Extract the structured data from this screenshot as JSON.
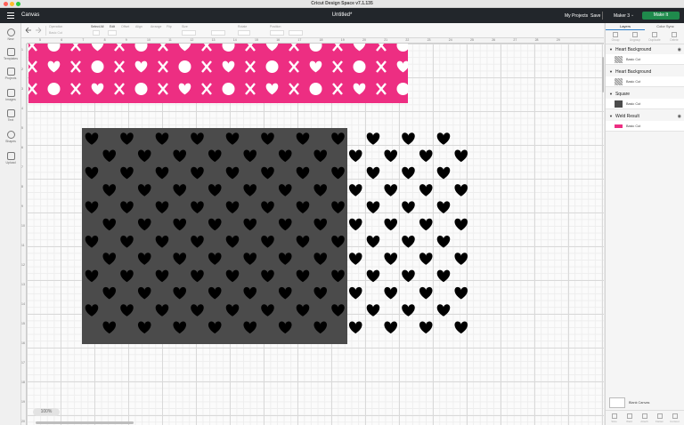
{
  "window": {
    "title": "Cricut Design Space  v7.1.135"
  },
  "header": {
    "section": "Canvas",
    "project_name": "Untitled*",
    "my_projects": "My Projects",
    "save": "Save",
    "machine": "Maker 3",
    "make_button": "Make It"
  },
  "toolbar": {
    "undo_icon": "undo-icon",
    "redo_icon": "redo-icon",
    "operation_label": "Operation",
    "operation_value": "Basic Cut",
    "select_all": "Select All",
    "edit": "Edit",
    "offset": "Offset",
    "align": "Align",
    "arrange": "Arrange",
    "flip": "Flip",
    "size": "Size",
    "rotate": "Rotate",
    "position": "Position"
  },
  "sidebar": {
    "items": [
      {
        "label": "New",
        "icon": "plus-icon"
      },
      {
        "label": "Templates",
        "icon": "template-icon"
      },
      {
        "label": "Projects",
        "icon": "projects-icon"
      },
      {
        "label": "Images",
        "icon": "images-icon"
      },
      {
        "label": "Text",
        "icon": "text-icon"
      },
      {
        "label": "Shapes",
        "icon": "shapes-icon"
      },
      {
        "label": "Upload",
        "icon": "upload-icon"
      }
    ]
  },
  "ruler": {
    "top": [
      "5",
      "6",
      "7",
      "8",
      "9",
      "10",
      "11",
      "12",
      "13",
      "14",
      "15",
      "16",
      "17",
      "18",
      "19",
      "20",
      "21",
      "22",
      "23",
      "24",
      "25",
      "26",
      "27",
      "28",
      "29"
    ],
    "left": [
      "1",
      "2",
      "3",
      "4",
      "5",
      "6",
      "7",
      "8",
      "9",
      "10",
      "11",
      "12",
      "13",
      "14",
      "15",
      "16",
      "17",
      "18",
      "19",
      "20",
      "21"
    ]
  },
  "canvas": {
    "zoom": "100%",
    "pink_color": "#ed2e82",
    "gray_color": "#4b4b4b",
    "heart_color": "#000000"
  },
  "layers_panel": {
    "tabs": [
      "Layers",
      "Color Sync"
    ],
    "actions": [
      "Group",
      "Ungroup",
      "Duplicate",
      "Delete"
    ],
    "groups": [
      {
        "name": "Heart Background",
        "item": "Basic Cut",
        "swatch": "pattern"
      },
      {
        "name": "Heart Background",
        "item": "Basic Cut",
        "swatch": "pattern"
      },
      {
        "name": "Square",
        "item": "Basic Cut",
        "swatch": "gray"
      },
      {
        "name": "Weld Result",
        "item": "Basic Cut",
        "swatch": "pink"
      }
    ],
    "blank_canvas": "Blank Canvas",
    "bottom_actions": [
      "Slice",
      "Weld",
      "Attach",
      "Flatten",
      "Contour"
    ]
  }
}
